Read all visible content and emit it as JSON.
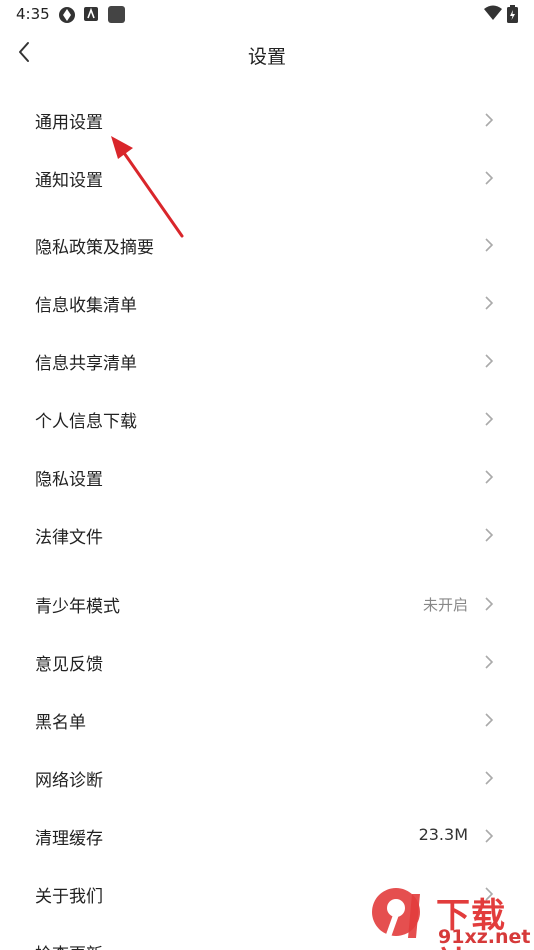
{
  "status_bar": {
    "time": "4:35"
  },
  "header": {
    "title": "设置"
  },
  "settings": {
    "items": [
      {
        "label": "通用设置",
        "value": ""
      },
      {
        "label": "通知设置",
        "value": ""
      },
      {
        "label": "隐私政策及摘要",
        "value": ""
      },
      {
        "label": "信息收集清单",
        "value": ""
      },
      {
        "label": "信息共享清单",
        "value": ""
      },
      {
        "label": "个人信息下载",
        "value": ""
      },
      {
        "label": "隐私设置",
        "value": ""
      },
      {
        "label": "法律文件",
        "value": ""
      },
      {
        "label": "青少年模式",
        "value": "未开启"
      },
      {
        "label": "意见反馈",
        "value": ""
      },
      {
        "label": "黑名单",
        "value": ""
      },
      {
        "label": "网络诊断",
        "value": ""
      },
      {
        "label": "清理缓存",
        "value": "23.3M"
      },
      {
        "label": "关于我们",
        "value": ""
      },
      {
        "label": "检查更新",
        "value": ""
      }
    ]
  },
  "watermark": {
    "line1": "下载站",
    "line2": "91xz.net"
  },
  "colors": {
    "annotation_arrow": "#d9262b",
    "watermark": "#e23c3c"
  }
}
